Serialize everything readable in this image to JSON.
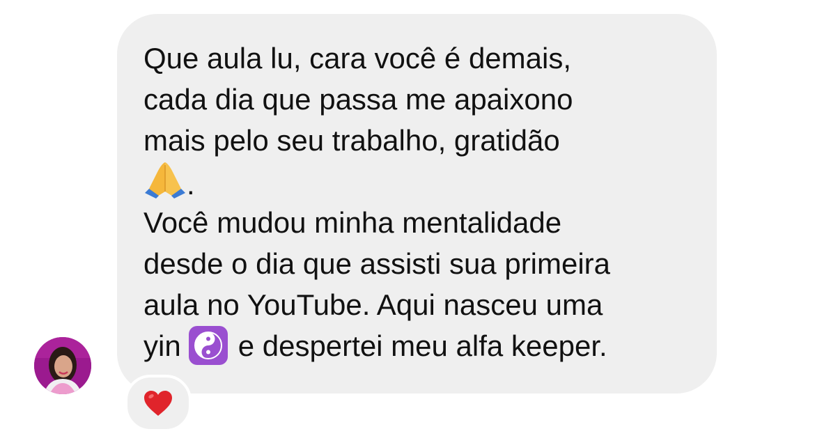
{
  "message": {
    "lines": [
      "Que aula lu, cara você é demais,",
      "cada dia que passa me apaixono",
      "mais pelo seu trabalho, gratidão",
      ".",
      "Você mudou minha mentalidade",
      "desde o dia que assisti sua primeira",
      "aula no YouTube. Aqui nasceu uma",
      "yin",
      "e despertei meu alfa keeper."
    ],
    "emojis": [
      "folded-hands-emoji",
      "yin-yang-emoji"
    ]
  },
  "reaction": {
    "icon": "red-heart-emoji",
    "color": "#e0242b"
  },
  "avatar": {
    "background_color": "#9b1a8f"
  },
  "colors": {
    "bubble": "#efefef",
    "text": "#111111",
    "background": "#ffffff"
  }
}
